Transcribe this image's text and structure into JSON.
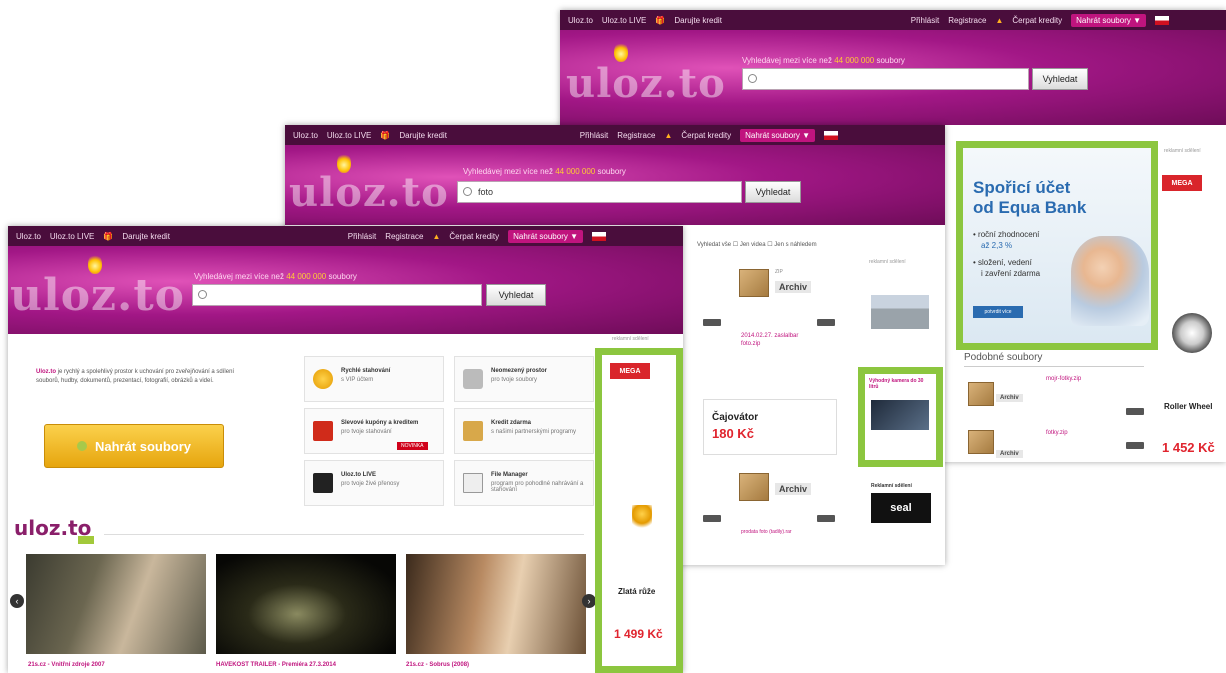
{
  "nav": {
    "link1": "Uloz.to",
    "link2": "Uloz.to LIVE",
    "gift": "Darujte kredit",
    "login": "Přihlásit",
    "register": "Registrace",
    "credit": "Čerpat kredity",
    "upload_pill": "Nahrát soubory ▼",
    "lang": "▼"
  },
  "brand": {
    "logo": "uloz.to",
    "logo_live": "uloz.to"
  },
  "search": {
    "label_pre": "Vyhledávej mezi více než ",
    "label_count": "44 000 000",
    "label_post": " soubory",
    "button": "Vyhledat",
    "query_middle": "foto"
  },
  "front": {
    "intro": "Uloz.to",
    "intro_rest": " je rychlý a spolehlivý prostor k uchování pro zveřejňování a sdílení souborů, hudby, dokumentů, prezentací, fotografií, obrázků a videí.",
    "upload_button": "Nahrát soubory",
    "features": [
      {
        "title": "Rychlé stahování",
        "sub": "s VIP účtem"
      },
      {
        "title": "Neomezený prostor",
        "sub": "pro tvoje soubory"
      },
      {
        "title": "Slevové kupóny a kreditem",
        "sub": "pro tvoje stahování"
      },
      {
        "title": "Kredit zdarma",
        "sub": "s našimi partnerskými programy"
      },
      {
        "title": "Uloz.to LIVE",
        "sub": "pro tvoje živé přenosy"
      },
      {
        "title": "File Manager",
        "sub": "program pro pohodlné nahrávání a stahování"
      }
    ],
    "badge": "NOVINKA",
    "videos": [
      {
        "caption": "21s.cz - Vnitřní zdroje 2007"
      },
      {
        "caption": "HAVEKOST TRAILER - Premiéra 27.3.2014"
      },
      {
        "caption": "21s.cz - Sobrus (2008)"
      }
    ]
  },
  "ads": {
    "label": "reklamní sdělení",
    "mega_brand": "MEGA",
    "rose_name": "Zlatá růže",
    "rose_price": "1 499 Kč",
    "bank_title_1": "Spořicí účet",
    "bank_title_2": "od Equa Bank",
    "bank_bullet_1": "• roční zhodnocení",
    "bank_bullet_1b": "až 2,3 %",
    "bank_bullet_2": "• složení, vedení",
    "bank_bullet_2b": "i zavření zdarma",
    "bank_cta": "potvrdit více",
    "roller_name": "Roller Wheel",
    "roller_price": "1 452 Kč",
    "camera_title": "Výhodný kamera do 30 litrů",
    "seal_text": "seal",
    "reklama_title": "Reklamní sdělení"
  },
  "middle": {
    "filter_text": "Vyhledat vše  ☐ Jen videa  ☐ Jen s náhledem",
    "archiv": "Archiv",
    "archiv_ext": "ZIP",
    "file_date": "2014.02.27. zaslalbar",
    "file_link": "foto.zip",
    "tea_name": "Čajovátor",
    "tea_price": "180 Kč",
    "file_link2": "prodata foto (tadily).rar"
  },
  "back": {
    "similar": "Podobné soubory",
    "item1": "mojr-fotky.zip",
    "item2": "fotky.zip",
    "archiv": "Archiv"
  }
}
